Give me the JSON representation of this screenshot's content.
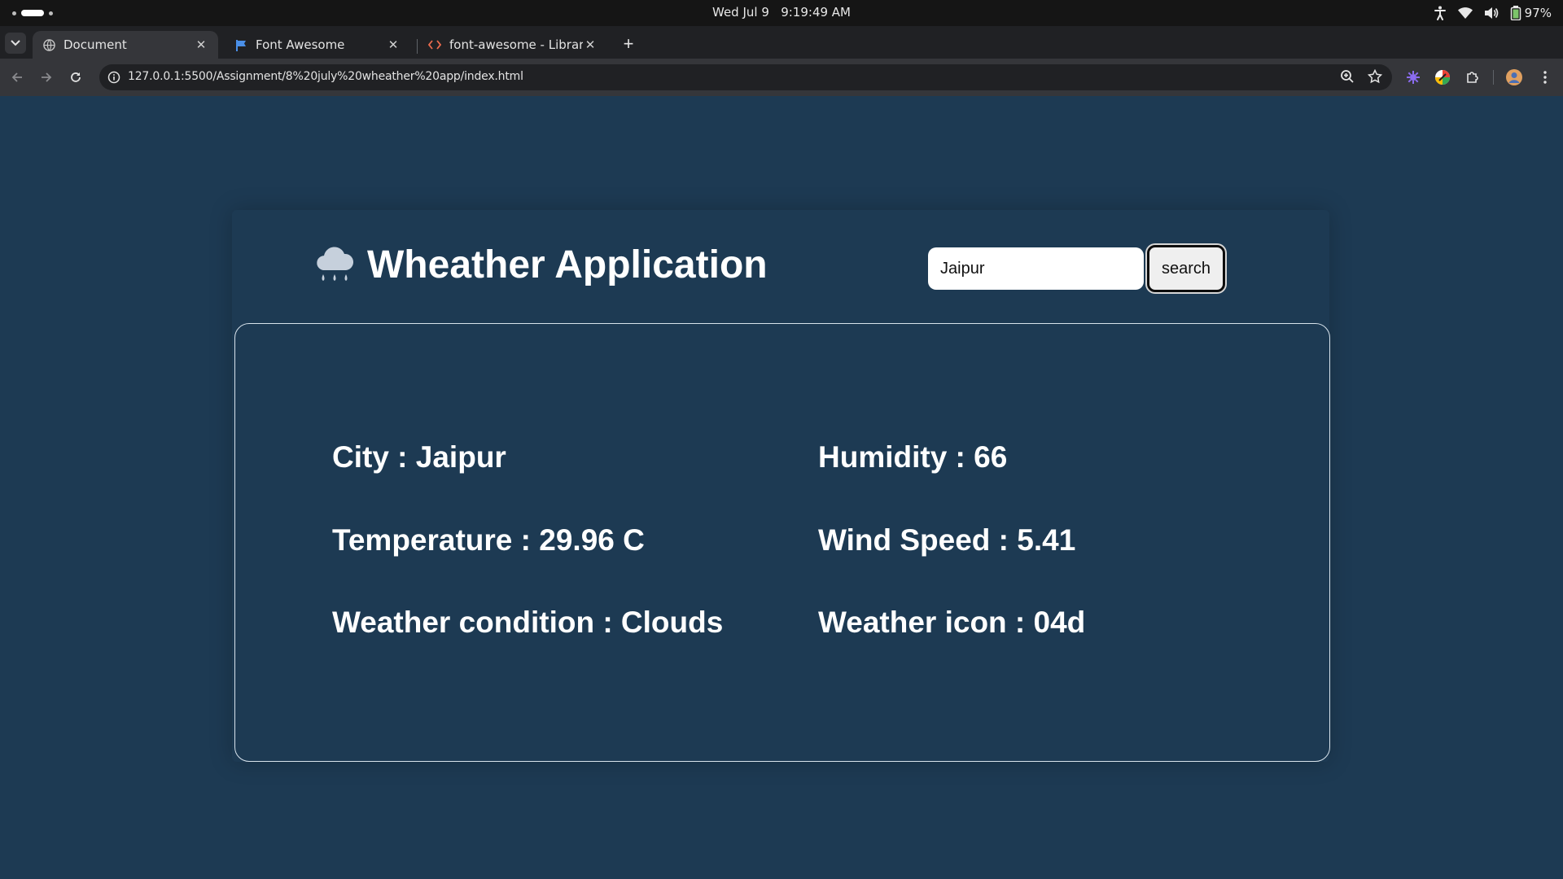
{
  "os": {
    "date": "Wed Jul 9",
    "time": "9:19:49 AM",
    "battery": "97%"
  },
  "browser": {
    "tabs": [
      {
        "title": "Document",
        "icon": "globe-icon",
        "active": true
      },
      {
        "title": "Font Awesome",
        "icon": "font-awesome-flag-icon",
        "active": false
      },
      {
        "title": "font-awesome - Libraries",
        "icon": "code-brackets-icon",
        "active": false
      }
    ],
    "url": "127.0.0.1:5500/Assignment/8%20july%20wheather%20app/index.html"
  },
  "app": {
    "icon": "cloud-showers-icon",
    "title": "Wheather Application",
    "search_value": "Jaipur",
    "search_button": "search",
    "info": {
      "city": "City : Jaipur",
      "temperature": "Temperature : 29.96 C",
      "condition": "Weather condition : Clouds",
      "humidity": "Humidity : 66",
      "wind": "Wind Speed : 5.41",
      "icon_code": "Weather icon : 04d"
    }
  },
  "colors": {
    "page_background": "#1d3a53",
    "browser_chrome": "#35363a",
    "text": "#ffffff"
  }
}
